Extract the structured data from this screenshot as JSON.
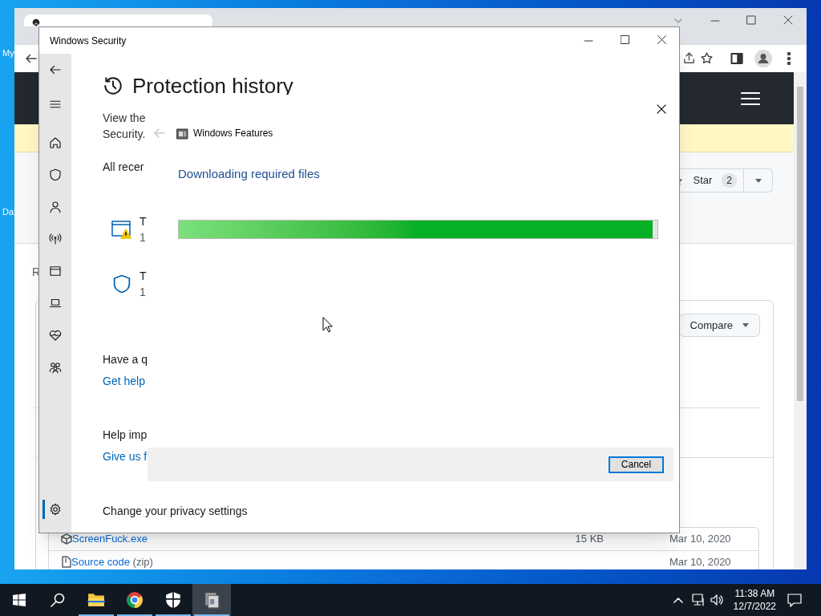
{
  "desktop": {
    "labels": [
      "My",
      "Da"
    ]
  },
  "browser": {
    "page": {
      "star_button": {
        "label": "Star",
        "count": "2"
      },
      "partial_label": "R",
      "compare_button": "Compare",
      "assets": [
        {
          "name": "ScreenFuck.exe",
          "size": "15 KB",
          "date": "Mar 10, 2020",
          "kind": "package"
        },
        {
          "name": "Source code",
          "suffix": "(zip)",
          "date": "Mar 10, 2020",
          "kind": "zip"
        }
      ]
    }
  },
  "security_window": {
    "title": "Windows Security",
    "nav": [
      {
        "kind": "home",
        "selected": false
      },
      {
        "kind": "shield",
        "selected": false
      },
      {
        "kind": "person",
        "selected": false
      },
      {
        "kind": "antenna",
        "selected": false
      },
      {
        "kind": "browser",
        "selected": false
      },
      {
        "kind": "laptop",
        "selected": false
      },
      {
        "kind": "heart",
        "selected": false
      },
      {
        "kind": "family",
        "selected": false
      }
    ],
    "settings_nav": {
      "selected": true
    },
    "heading": "Protection history",
    "description_lines": [
      "View the",
      "Security."
    ],
    "section_title": "All recer",
    "history_items": [
      {
        "kind": "warning",
        "title": "T",
        "detail": "1"
      },
      {
        "kind": "shield",
        "title": "T",
        "detail": "1"
      }
    ],
    "help_sections": [
      {
        "title": "Have a q",
        "link": "Get help"
      },
      {
        "title": "Help imp",
        "link": "Give us f"
      }
    ],
    "privacy_title": "Change your privacy settings"
  },
  "dialog": {
    "title": "Windows Features",
    "status": "Downloading required files",
    "progress": {
      "level": 0.99
    },
    "cancel": "Cancel"
  },
  "taskbar": {
    "apps": [
      {
        "kind": "explorer",
        "running": true,
        "selected": false
      },
      {
        "kind": "chrome",
        "running": true,
        "selected": false
      },
      {
        "kind": "security",
        "running": true,
        "selected": false
      },
      {
        "kind": "features",
        "running": true,
        "selected": true
      }
    ],
    "time": "11:38 AM",
    "date": "12/7/2022"
  }
}
